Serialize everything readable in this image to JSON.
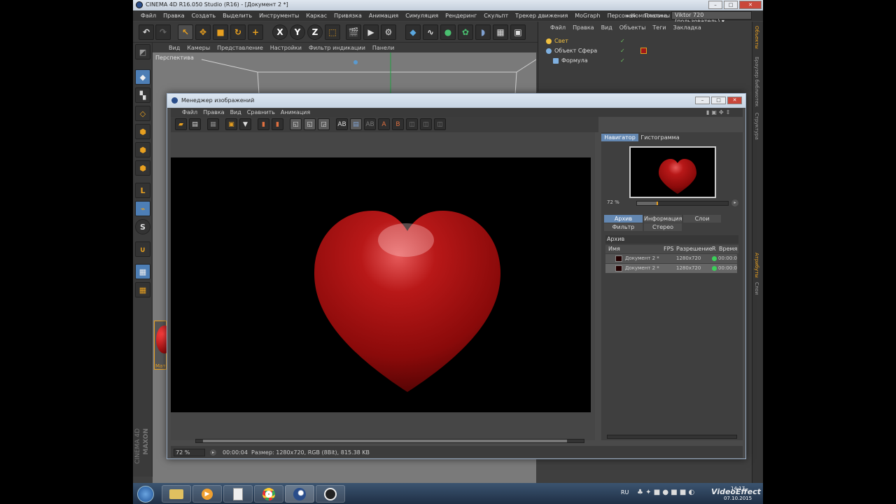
{
  "app": {
    "title": "CINEMA 4D R16.050 Studio (R16) - [Документ 2 *]",
    "menu": [
      "Файл",
      "Правка",
      "Создать",
      "Выделить",
      "Инструменты",
      "Каркас",
      "Привязка",
      "Анимация",
      "Симуляция",
      "Рендеринг",
      "Скульпт",
      "Трекер движения",
      "MoGraph",
      "Персонаж",
      "Плагины"
    ],
    "layout_label": "Компоновка",
    "layout_value": "Viktor 720 (пользователь)"
  },
  "viewport": {
    "menu": [
      "Вид",
      "Камеры",
      "Представление",
      "Настройки",
      "Фильтр индикации",
      "Панели"
    ],
    "label": "Перспектива"
  },
  "object_manager": {
    "menu": [
      "Файл",
      "Правка",
      "Вид",
      "Объекты",
      "Теги",
      "Закладка"
    ],
    "objects": [
      {
        "name": "Свет",
        "color": "#f0c040"
      },
      {
        "name": "Объект Сфера",
        "color": "#7fb0e0"
      },
      {
        "name": "Формула",
        "color": "#7fb0e0"
      }
    ]
  },
  "side_tabs": [
    "Объекты",
    "Браузер библиотек",
    "Структура",
    "Атрибуты",
    "Слои"
  ],
  "material_label": "Мате",
  "picture_viewer": {
    "title": "Менеджер изображений",
    "menu": [
      "Файл",
      "Правка",
      "Вид",
      "Сравнить",
      "Анимация"
    ],
    "tabs_top": [
      "Навигатор",
      "Гистограмма"
    ],
    "nav_zoom": "72 %",
    "tabs_archive": [
      "Архив",
      "Информация",
      "Слои"
    ],
    "tabs_archive2": [
      "Фильтр",
      "Стерео"
    ],
    "archive_header": "Архив",
    "columns": [
      "Имя",
      "FPS",
      "Разрешение",
      "R",
      "Время"
    ],
    "rows": [
      {
        "name": "Документ 2 *",
        "res": "1280x720",
        "time": "00:00:0"
      },
      {
        "name": "Документ 2 *",
        "res": "1280x720",
        "time": "00:00:0"
      }
    ],
    "status_zoom": "72 %",
    "status_time": "00:00:04",
    "status_info": "Размер: 1280x720, RGB (8Bit), 815.38 KB"
  },
  "brand": {
    "line1": "MAXON",
    "line2": "CINEMA 4D"
  },
  "taskbar": {
    "lang": "RU",
    "clock": "14:17",
    "date": "07.10.2015",
    "watermark": "VideoEffect"
  },
  "colors": {
    "accent": "#6387b1",
    "heart": "#b01010"
  }
}
